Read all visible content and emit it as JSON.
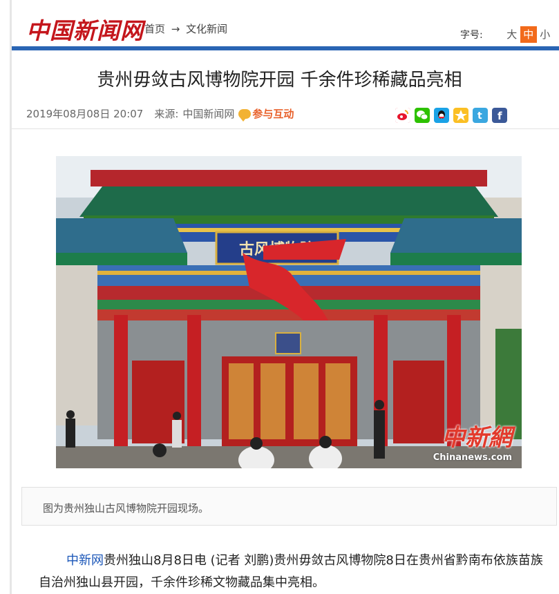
{
  "header": {
    "logo": "中国新闻网",
    "breadcrumb": [
      "首页",
      "文化新闻"
    ],
    "breadcrumb_arrow": "→",
    "font_size_label": "字号:",
    "font_size_options": [
      "大",
      "中",
      "小"
    ],
    "font_size_selected": "中"
  },
  "article": {
    "title": "贵州毋敛古风博物院开园 千余件珍稀藏品亮相",
    "datetime": "2019年08月08日 20:07",
    "source_label": "来源:",
    "source_name": "中国新闻网",
    "interact_label": "参与互动",
    "share_icons": [
      "weibo-icon",
      "wechat-icon",
      "qq-icon",
      "qzone-icon",
      "tencent-weibo-icon",
      "facebook-icon"
    ]
  },
  "photo": {
    "sign_text": "古风博物院",
    "watermark_cn": "中新網",
    "watermark_en": "Chinanews.com",
    "caption": "图为贵州独山古风博物院开园现场。"
  },
  "body": {
    "lead_source": "中新网",
    "paragraph": "贵州独山8月8日电 (记者 刘鹏)贵州毋敛古风博物院8日在贵州省黔南布依族苗族自治州独山县开园，千余件珍稀文物藏品集中亮相。"
  },
  "colors": {
    "brand_red": "#c4161c",
    "nav_blue": "#2a65b4",
    "accent_orange": "#f26a1b",
    "link_blue": "#1a56b8"
  }
}
